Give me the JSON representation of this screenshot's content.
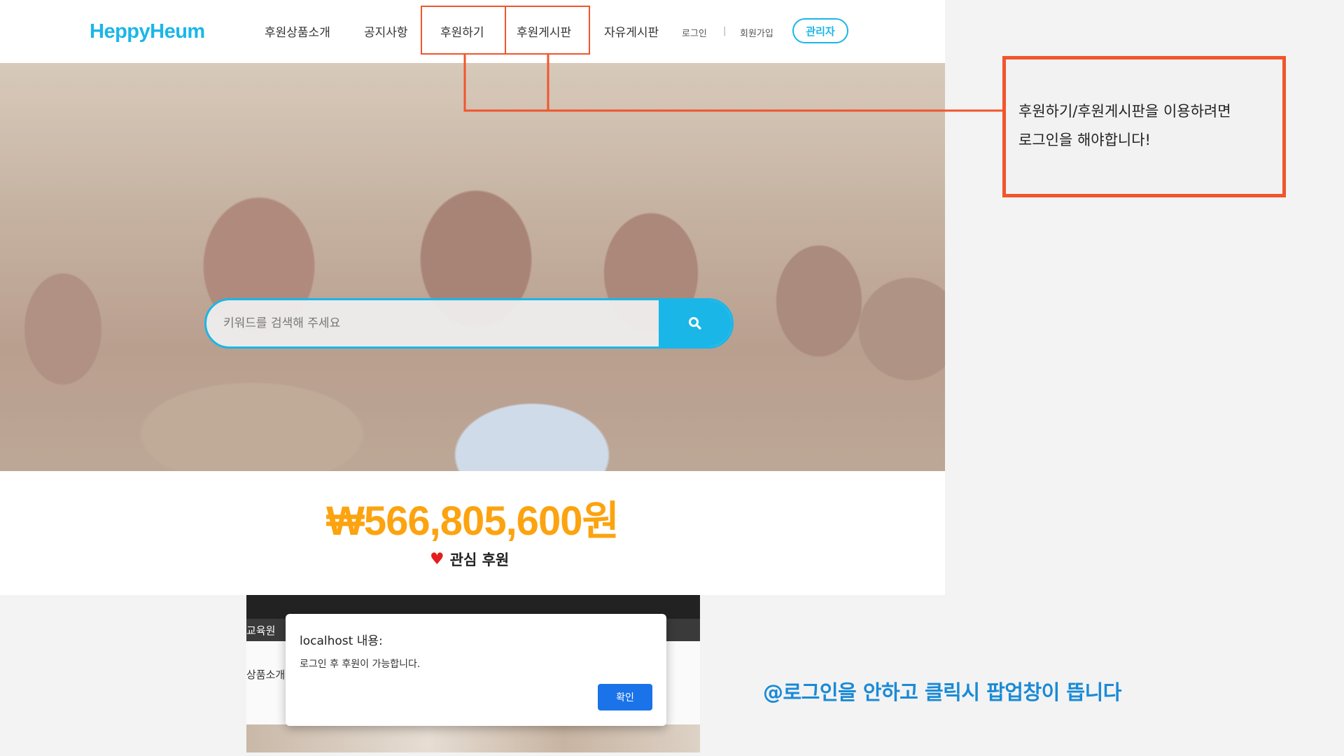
{
  "header": {
    "logo": "HeppyHeum",
    "nav": [
      {
        "label": "후원상품소개"
      },
      {
        "label": "공지사항"
      },
      {
        "label": "후원하기"
      },
      {
        "label": "후원게시판"
      },
      {
        "label": "자유게시판"
      }
    ],
    "login_label": "로그인",
    "separator": "|",
    "signup_label": "회원가입",
    "admin_label": "관리자"
  },
  "search": {
    "placeholder": "키워드를 검색해 주세요",
    "icon": "search-icon"
  },
  "stats": {
    "amount": "₩566,805,600원",
    "interest_label": "관심 후원",
    "interest_icon": "heart-icon"
  },
  "annotation": {
    "callout_line1": "후원하기/후원게시판을 이용하려면",
    "callout_line2": "로그인을 해야합니다!",
    "note": "@로그인을 안하고 클릭시 팝업창이 뜹니다",
    "highlight_color": "#f1552c"
  },
  "screenshot": {
    "header_text": "교육원",
    "sub_text": "상품소개",
    "dialog_title": "localhost 내용:",
    "dialog_message": "로그인 후 후원이 가능합니다.",
    "ok_label": "확인"
  },
  "colors": {
    "brand": "#1ab6e8",
    "amount": "#fca310",
    "note": "#1a8ad6",
    "dialog_button": "#1a73e8"
  }
}
